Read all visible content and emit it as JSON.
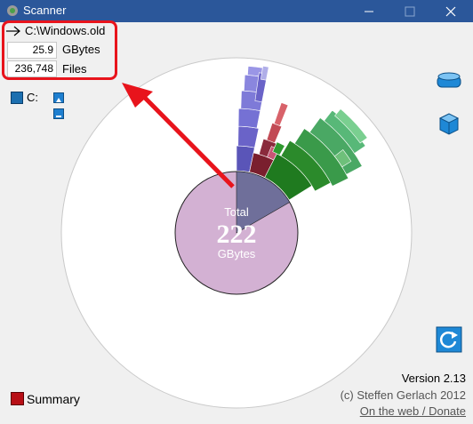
{
  "window": {
    "title": "Scanner"
  },
  "stats": {
    "path": "C:\\Windows.old",
    "size_value": "25.9",
    "size_unit": "GBytes",
    "files_value": "236,748",
    "files_unit": "Files"
  },
  "drives": [
    {
      "label": "C:"
    }
  ],
  "center": {
    "label": "Total",
    "value": "222",
    "unit": "GBytes"
  },
  "footer": {
    "version": "Version 2.13",
    "copyright": "(c) Steffen Gerlach 2012",
    "link": "On the web / Donate"
  },
  "summary": {
    "label": "Summary"
  },
  "colors": {
    "titlebar": "#2b579a",
    "highlight": "#e8141c",
    "center_disk": "#d3b1d3",
    "selected_wedge": "#6f6f9a",
    "blue_ring": "#6a63c8",
    "red_ring": "#8a2a3c",
    "green_ring": "#2b8a2b"
  }
}
